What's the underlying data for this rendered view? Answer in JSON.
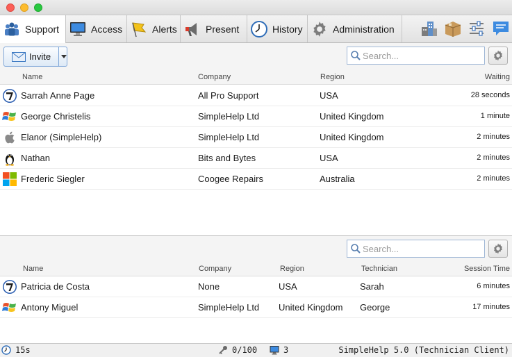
{
  "window": {
    "buttons": [
      "close",
      "minimize",
      "zoom"
    ]
  },
  "tabs": [
    {
      "label": "Support",
      "icon": "support-people-icon",
      "active": true
    },
    {
      "label": "Access",
      "icon": "monitor-icon",
      "active": false
    },
    {
      "label": "Alerts",
      "icon": "flag-icon",
      "active": false
    },
    {
      "label": "Present",
      "icon": "megaphone-icon",
      "active": false
    },
    {
      "label": "History",
      "icon": "clock-icon",
      "active": false
    },
    {
      "label": "Administration",
      "icon": "gear-icon",
      "active": false
    }
  ],
  "tools": [
    {
      "icon": "buildings-icon"
    },
    {
      "icon": "package-icon"
    },
    {
      "icon": "sliders-icon"
    },
    {
      "icon": "chat-icon"
    }
  ],
  "waiting": {
    "invite_label": "Invite",
    "search_placeholder": "Search...",
    "columns": {
      "name": "Name",
      "company": "Company",
      "region": "Region",
      "waiting": "Waiting"
    },
    "rows": [
      {
        "os": "windows7",
        "name": "Sarrah Anne Page",
        "company": "All Pro Support",
        "region": "USA",
        "waiting": "28 seconds"
      },
      {
        "os": "windowsxp",
        "name": "George Christelis",
        "company": "SimpleHelp Ltd",
        "region": "United Kingdom",
        "waiting": "1 minute"
      },
      {
        "os": "apple",
        "name": "Elanor (SimpleHelp)",
        "company": "SimpleHelp Ltd",
        "region": "United Kingdom",
        "waiting": "2 minutes"
      },
      {
        "os": "linux",
        "name": "Nathan",
        "company": "Bits and Bytes",
        "region": "USA",
        "waiting": "2 minutes"
      },
      {
        "os": "windows8",
        "name": "Frederic Siegler",
        "company": "Coogee Repairs",
        "region": "Australia",
        "waiting": "2 minutes"
      }
    ]
  },
  "sessions": {
    "search_placeholder": "Search...",
    "columns": {
      "name": "Name",
      "company": "Company",
      "region": "Region",
      "technician": "Technician",
      "session_time": "Session Time"
    },
    "rows": [
      {
        "os": "windows7",
        "name": "Patricia de Costa",
        "company": "None",
        "region": "USA",
        "technician": "Sarah",
        "session_time": "6 minutes"
      },
      {
        "os": "windowsxp",
        "name": "Antony Miguel",
        "company": "SimpleHelp Ltd",
        "region": "United Kingdom",
        "technician": "George",
        "session_time": "17 minutes"
      }
    ]
  },
  "status": {
    "timer": "15s",
    "keys": "0/100",
    "monitors": "3",
    "app_title": "SimpleHelp 5.0 (Technician Client)"
  },
  "colors": {
    "accent": "#3a78c2",
    "tab_bar": "#e2e2e2",
    "row_divider": "#ececec"
  }
}
